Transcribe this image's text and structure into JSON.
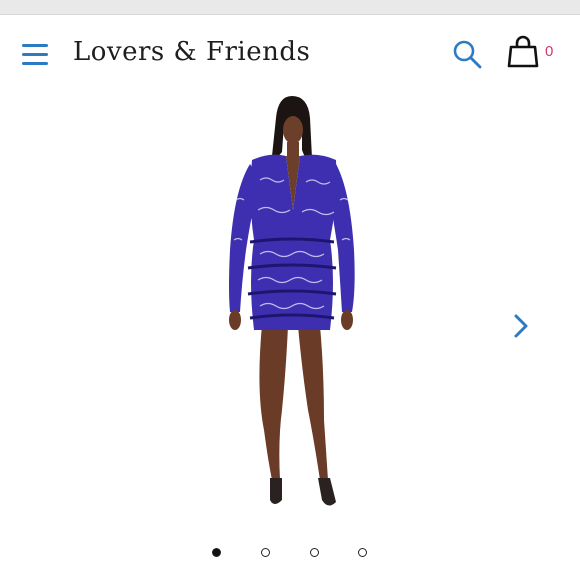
{
  "header": {
    "brand": "Lovers & Friends",
    "cart_count": "0"
  },
  "icons": {
    "menu": "hamburger-menu-icon",
    "search": "search-icon",
    "cart": "shopping-bag-icon",
    "next": "chevron-right-icon"
  },
  "carousel": {
    "total_images": 4,
    "active_index": 1
  },
  "colors": {
    "accent": "#2b7bc4",
    "cart_count": "#d9366a",
    "dress": "#3d2fb0"
  }
}
